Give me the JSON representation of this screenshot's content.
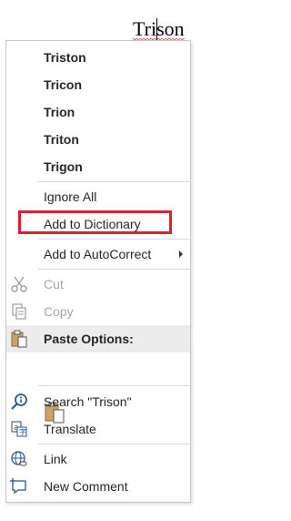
{
  "document": {
    "misspelled_word": "Trison"
  },
  "menu": {
    "suggestions": [
      "Triston",
      "Tricon",
      "Trion",
      "Triton",
      "Trigon"
    ],
    "ignore_all": "Ignore All",
    "add_to_dictionary": "Add to Dictionary",
    "add_to_autocorrect": "Add to AutoCorrect",
    "cut": "Cut",
    "copy": "Copy",
    "paste_options_header": "Paste Options:",
    "search": "Search \"Trison\"",
    "translate": "Translate",
    "link": "Link",
    "new_comment": "New Comment"
  },
  "colors": {
    "highlight_border": "#d8212b",
    "spelling_squiggle": "#d23434",
    "icon_blue": "#2b5797",
    "clipboard_tan": "#c8a36a"
  },
  "icons": {
    "cut": "scissors-icon",
    "copy": "copy-icon",
    "paste": "clipboard-icon",
    "search": "smart-lookup-icon",
    "translate": "translate-icon",
    "link": "globe-link-icon",
    "comment": "comment-icon"
  }
}
